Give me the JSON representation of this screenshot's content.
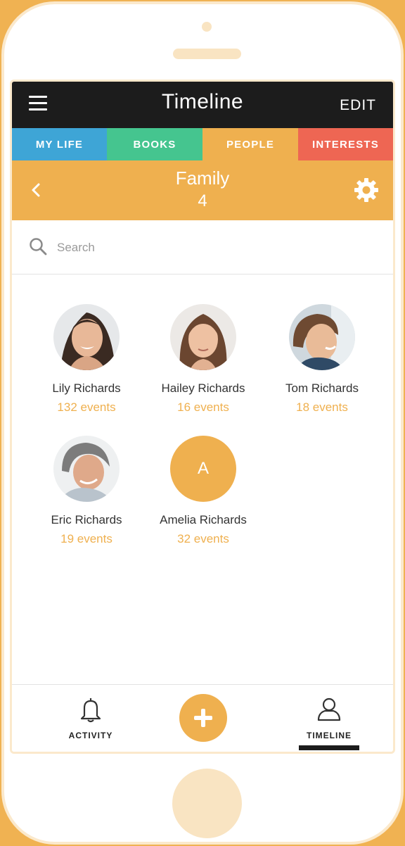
{
  "header": {
    "title": "Timeline",
    "edit_label": "EDIT"
  },
  "tabs": [
    {
      "label": "MY LIFE",
      "color": "#3ea5d6"
    },
    {
      "label": "BOOKS",
      "color": "#45c58f"
    },
    {
      "label": "PEOPLE",
      "color": "#efb04f",
      "active": true
    },
    {
      "label": "INTERESTS",
      "color": "#ee6653"
    }
  ],
  "group": {
    "name": "Family",
    "count": "4"
  },
  "search": {
    "placeholder": "Search",
    "value": ""
  },
  "people": [
    {
      "name": "Lily Richards",
      "events": "132 events",
      "avatar": "photo"
    },
    {
      "name": "Hailey Richards",
      "events": "16 events",
      "avatar": "photo"
    },
    {
      "name": "Tom Richards",
      "events": "18 events",
      "avatar": "photo"
    },
    {
      "name": "Eric Richards",
      "events": "19 events",
      "avatar": "photo"
    },
    {
      "name": "Amelia Richards",
      "events": "32 events",
      "avatar": "initial",
      "initial": "A"
    }
  ],
  "bottom_nav": {
    "activity_label": "ACTIVITY",
    "timeline_label": "TIMELINE",
    "active": "timeline"
  },
  "colors": {
    "accent": "#efb04f",
    "dark": "#1c1c1c",
    "frame": "#f0b252"
  }
}
